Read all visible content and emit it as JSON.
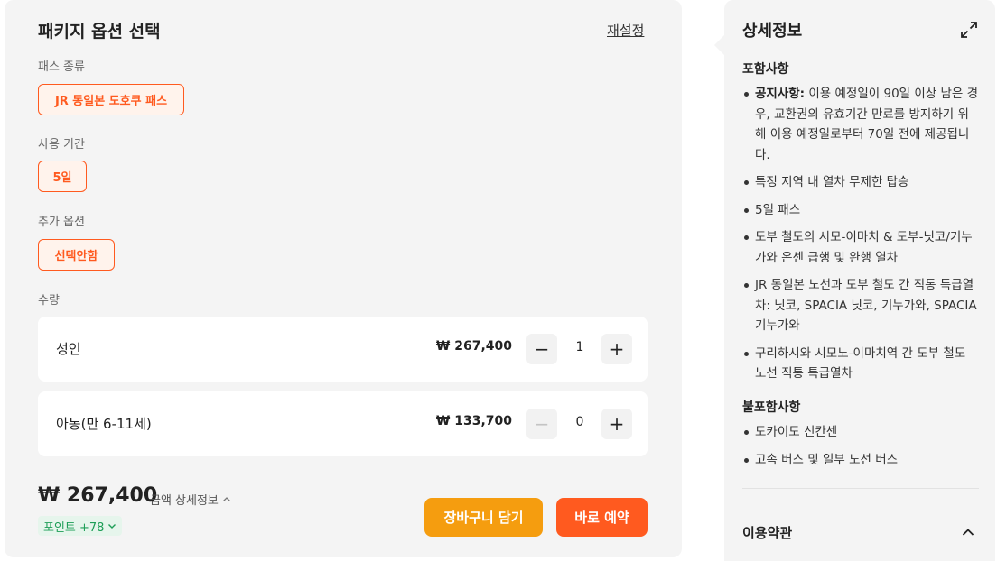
{
  "options": {
    "title": "패키지 옵션 선택",
    "reset_label": "재설정",
    "pass_type": {
      "label": "패스 종류",
      "selected": "JR 동일본 도호쿠 패스"
    },
    "duration": {
      "label": "사용 기간",
      "selected": "5일"
    },
    "extra": {
      "label": "추가 옵션",
      "selected": "선택안함"
    },
    "quantity": {
      "label": "수량",
      "rows": [
        {
          "name": "성인",
          "price": "₩ 267,400",
          "count": "1"
        },
        {
          "name": "아동(만 6-11세)",
          "price": "₩ 133,700",
          "count": "0"
        }
      ]
    }
  },
  "summary": {
    "total": "₩ 267,400",
    "detail_label": "금액 상세정보",
    "points": "포인트 +78",
    "cart_button": "장바구니 담기",
    "buy_button": "바로 예약"
  },
  "details": {
    "title": "상세정보",
    "included_title": "포함사항",
    "included_first_bold": "공지사항:",
    "included_first_rest": " 이용 예정일이 90일 이상 남은 경우, 교환권의 유효기간 만료를 방지하기 위해 이용 예정일로부터 70일 전에 제공됩니다.",
    "included": [
      "특정 지역 내 열차 무제한 탑승",
      "5일 패스",
      "도부 철도의 시모-이마치 & 도부-닛코/기누가와 온센 급행 및 완행 열차",
      "JR 동일본 노선과 도부 철도 간 직통 특급열차: 닛코, SPACIA 닛코, 기누가와, SPACIA 기누가와",
      "구리하시와 시모노-이마치역 간 도부 철도 노선 직통 특급열차"
    ],
    "excluded_title": "불포함사항",
    "excluded": [
      "도카이도 신칸센",
      "고속 버스 및 일부 노선 버스"
    ],
    "terms_label": "이용약관"
  },
  "colors": {
    "accent": "#ff5a1f",
    "cart": "#f59d0f",
    "points": "#1e9e57",
    "panel_bg": "#f4f4f4"
  }
}
